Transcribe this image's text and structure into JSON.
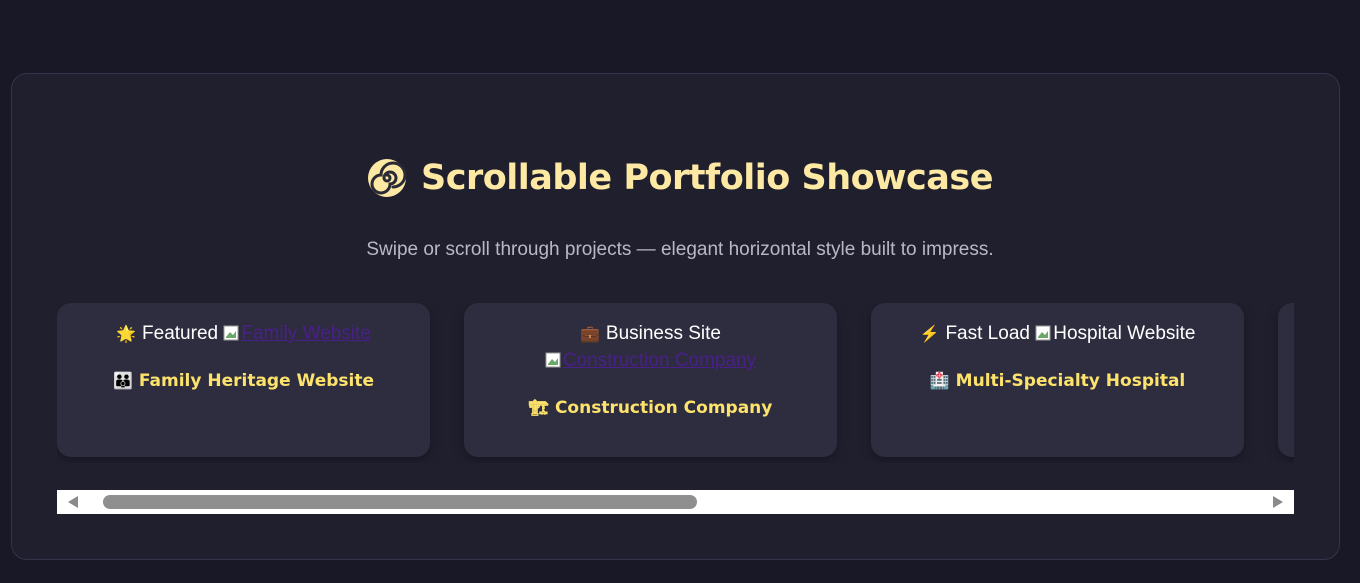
{
  "header": {
    "icon": "spiral-icon",
    "title": "Scrollable Portfolio Showcase",
    "subtitle": "Swipe or scroll through projects — elegant horizontal style built to impress."
  },
  "cards": [
    {
      "badge_emoji": "🌟",
      "badge_label": "Featured",
      "image_alt": "Family Website",
      "name_emoji": "👪",
      "name": "Family Heritage Website"
    },
    {
      "badge_emoji": "💼",
      "badge_label": "Business Site",
      "image_alt": "Construction Company",
      "name_emoji": "🏗",
      "name": "Construction Company"
    },
    {
      "badge_emoji": "⚡",
      "badge_label": "Fast Load",
      "image_alt": "Hospital Website",
      "name_emoji": "🏥",
      "name": "Multi-Specialty Hospital"
    }
  ],
  "colors": {
    "background": "#181826",
    "panel": "#1f1f2e",
    "card": "#2d2d3f",
    "title": "#fde9a3",
    "card_name": "#fde36b",
    "alt_link": "#4a1f8a"
  },
  "scrollbar": {
    "position_fraction": 0.0,
    "visible_fraction": 0.5
  }
}
